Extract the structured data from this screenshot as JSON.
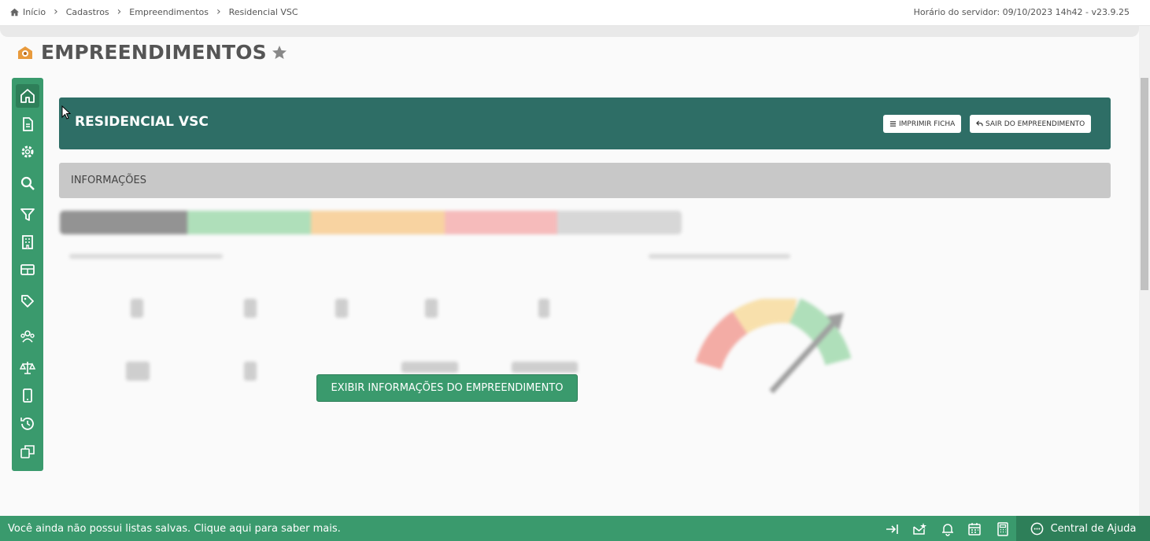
{
  "breadcrumb": {
    "items": [
      "Início",
      "Cadastros",
      "Empreendimentos",
      "Residencial VSC"
    ]
  },
  "server_info": "Horário do servidor: 09/10/2023 14h42 - v23.9.25",
  "page": {
    "title": "EMPREENDIMENTOS"
  },
  "sidebar": {
    "icons": [
      "home-icon",
      "document-icon",
      "gear-icon",
      "search-icon",
      "filter-icon",
      "building-icon",
      "table-icon",
      "tag-icon",
      "users-icon",
      "scale-icon",
      "mobile-icon",
      "history-icon",
      "copy-icon"
    ]
  },
  "header": {
    "title": "RESIDENCIAL VSC",
    "print_label": "IMPRIMIR FICHA",
    "exit_label": "SAIR DO EMPREENDIMENTO"
  },
  "info_section": {
    "label": "INFORMAÇÕES"
  },
  "overlay": {
    "button_label": "EXIBIR INFORMAÇÕES DO EMPREENDIMENTO"
  },
  "colors": {
    "primary": "#3a9a6d",
    "header": "#2e6e66",
    "legend": [
      "#666666",
      "#8fd39e",
      "#f7c27a",
      "#f4a0a0",
      "#c8c8c8"
    ]
  },
  "footer": {
    "message": "Você ainda não possui listas salvas. Clique aqui para saber mais.",
    "icons": [
      "dock-right-icon",
      "mail-star-icon",
      "bell-icon",
      "calendar-icon",
      "calculator-icon"
    ],
    "help_label": "Central de Ajuda"
  }
}
